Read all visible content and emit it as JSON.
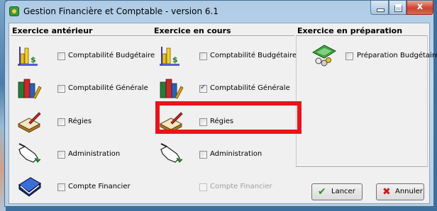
{
  "window": {
    "title": "Gestion Financière et Comptable - version 6.1",
    "close_label": "x"
  },
  "panels": [
    {
      "heading": "Exercice antérieur",
      "items": [
        {
          "label": "Comptabilité Budgétaire",
          "icon": "budget-chart-icon",
          "checked": false,
          "enabled": true
        },
        {
          "label": "Comptabilité Générale",
          "icon": "books-icon",
          "checked": false,
          "enabled": true
        },
        {
          "label": "Régies",
          "icon": "ledger-pen-icon",
          "checked": false,
          "enabled": true
        },
        {
          "label": "Administration",
          "icon": "hand-pointer-icon",
          "checked": false,
          "enabled": true
        },
        {
          "label": "Compte Financier",
          "icon": "blue-book-icon",
          "checked": false,
          "enabled": true
        }
      ]
    },
    {
      "heading": "Exercice en cours",
      "items": [
        {
          "label": "Comptabilité Budgétaire",
          "icon": "budget-chart-icon",
          "checked": false,
          "enabled": true
        },
        {
          "label": "Comptabilité Générale",
          "icon": "books-icon",
          "checked": true,
          "enabled": true
        },
        {
          "label": "Régies",
          "icon": "ledger-pen-icon",
          "checked": false,
          "enabled": true
        },
        {
          "label": "Administration",
          "icon": "hand-pointer-icon",
          "checked": false,
          "enabled": true
        },
        {
          "label": "Compte Financier",
          "icon": "blue-book-icon",
          "checked": false,
          "enabled": false
        }
      ]
    },
    {
      "heading": "Exercice en préparation",
      "items": [
        {
          "label": "Préparation Budgétaire",
          "icon": "money-coins-icon",
          "checked": false,
          "enabled": true
        }
      ]
    }
  ],
  "buttons": {
    "launch": "Lancer",
    "cancel": "Annuler"
  },
  "colors": {
    "highlight": "#e8141b",
    "titlebar": "#b8d0e6"
  }
}
